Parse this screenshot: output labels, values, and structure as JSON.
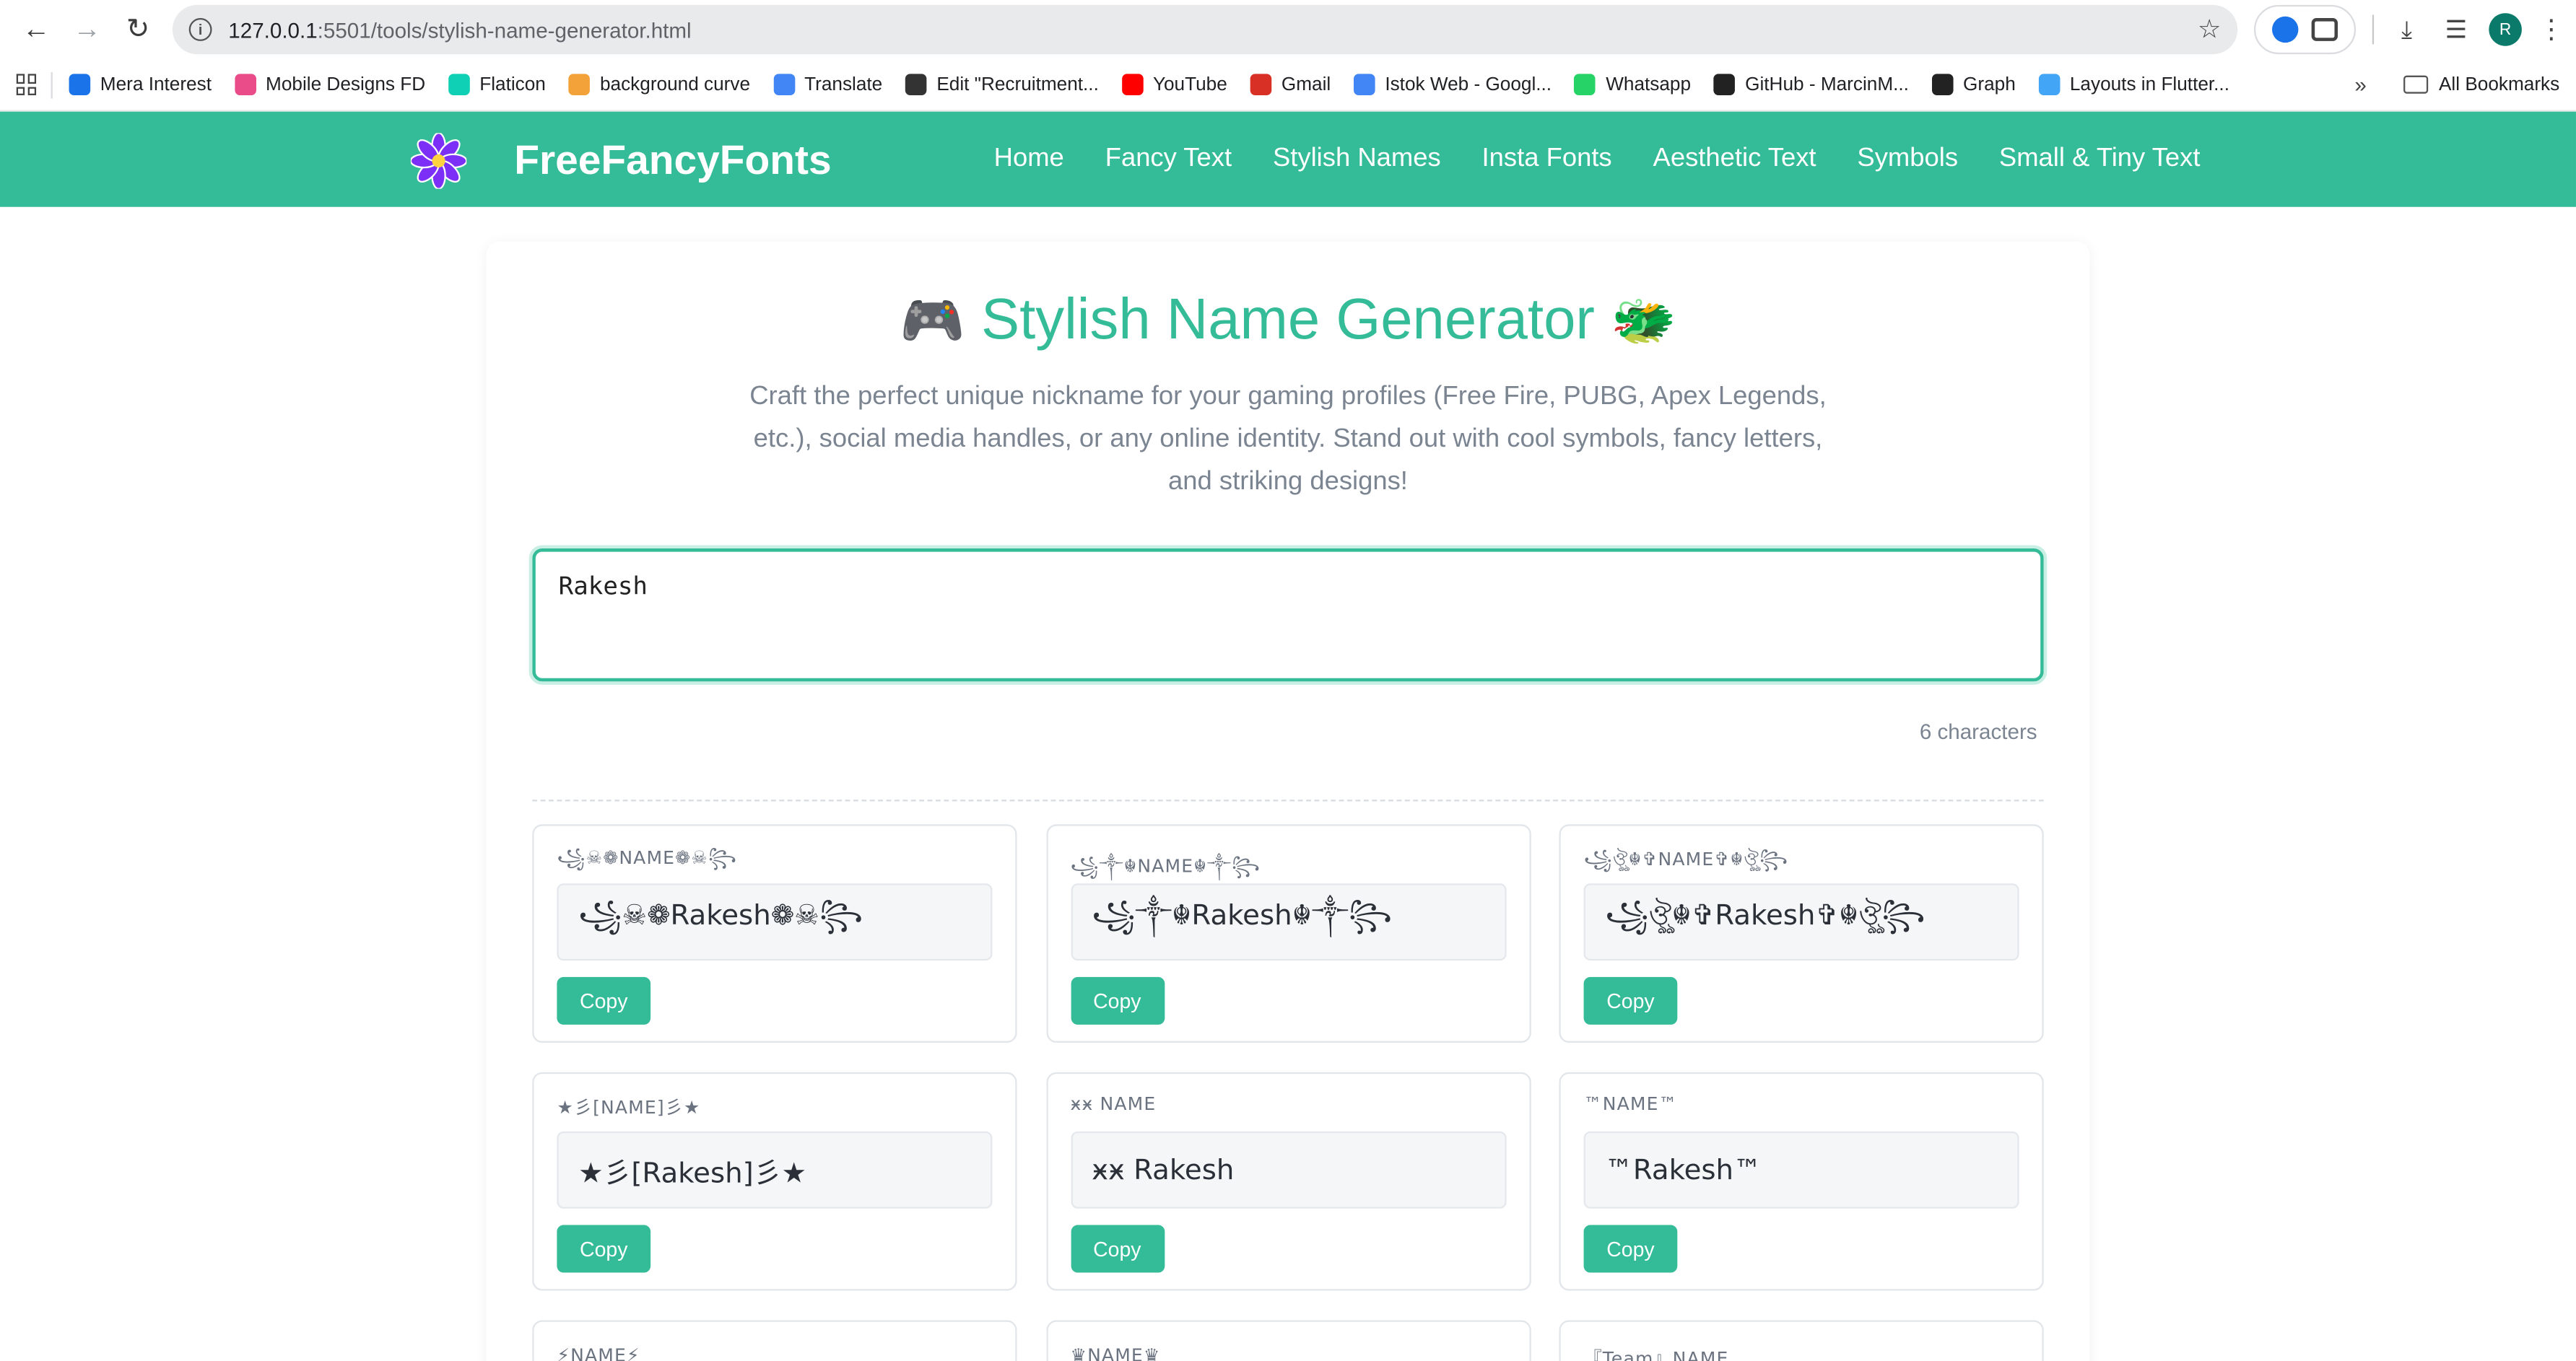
{
  "browser": {
    "url_host": "127.0.0.1",
    "url_path": ":5501/tools/stylish-name-generator.html",
    "avatar_letter": "R"
  },
  "bookmarks": [
    {
      "label": "Mera Interest",
      "color": "#1a73e8"
    },
    {
      "label": "Mobile Designs FD",
      "color": "#ea4c89"
    },
    {
      "label": "Flaticon",
      "color": "#0fcfb4"
    },
    {
      "label": "background curve",
      "color": "#f3a23a"
    },
    {
      "label": "Translate",
      "color": "#4285f4"
    },
    {
      "label": "Edit \"Recruitment...",
      "color": "#333333"
    },
    {
      "label": "YouTube",
      "color": "#ff0000"
    },
    {
      "label": "Gmail",
      "color": "#d93025"
    },
    {
      "label": "Istok Web - Googl...",
      "color": "#4285f4"
    },
    {
      "label": "Whatsapp",
      "color": "#25d366"
    },
    {
      "label": "GitHub - MarcinM...",
      "color": "#222222"
    },
    {
      "label": "Graph",
      "color": "#222222"
    },
    {
      "label": "Layouts in Flutter...",
      "color": "#42a5f5"
    }
  ],
  "all_bookmarks": "All Bookmarks",
  "site": {
    "brand": "FreeFancyFonts",
    "accent": "#34bb97",
    "menu": [
      "Home",
      "Fancy Text",
      "Stylish Names",
      "Insta Fonts",
      "Aesthetic Text",
      "Symbols",
      "Small & Tiny Text"
    ]
  },
  "main": {
    "title_emoji_left": "🎮",
    "title": "Stylish Name Generator",
    "title_emoji_right": "🐲",
    "subtitle": "Craft the perfect unique nickname for your gaming profiles (Free Fire, PUBG, Apex Legends, etc.), social media handles, or any online identity. Stand out with cool symbols, fancy letters, and striking designs!",
    "input_value": "Rakesh",
    "char_count": "6 characters"
  },
  "results": [
    {
      "label": "꧁☠︎❁NAME❁☠︎꧂",
      "output": "꧁☠︎❁Rakesh❁☠︎꧂",
      "copy": "Copy"
    },
    {
      "label": "꧁༒☬NAME☬༒꧂",
      "output": "꧁༒☬Rakesh☬༒꧂",
      "copy": "Copy"
    },
    {
      "label": "꧁ঔৣ☬✞NAME✞☬ঔৣ꧂",
      "output": "꧁ঔৣ☬✞Rakesh✞☬ঔৣ꧂",
      "copy": "Copy"
    },
    {
      "label": "★彡[NAME]彡★",
      "output": "★彡[Rakesh]彡★",
      "copy": "Copy"
    },
    {
      "label": "ӿӿ  NAME",
      "output": "ӿӿ  Rakesh",
      "copy": "Copy"
    },
    {
      "label": "™NAME™",
      "output": "™Rakesh™",
      "copy": "Copy"
    }
  ],
  "results_partial": [
    {
      "label": "⚡NAME⚡"
    },
    {
      "label": "♛NAME♛"
    },
    {
      "label": "『Team』NAME"
    }
  ]
}
